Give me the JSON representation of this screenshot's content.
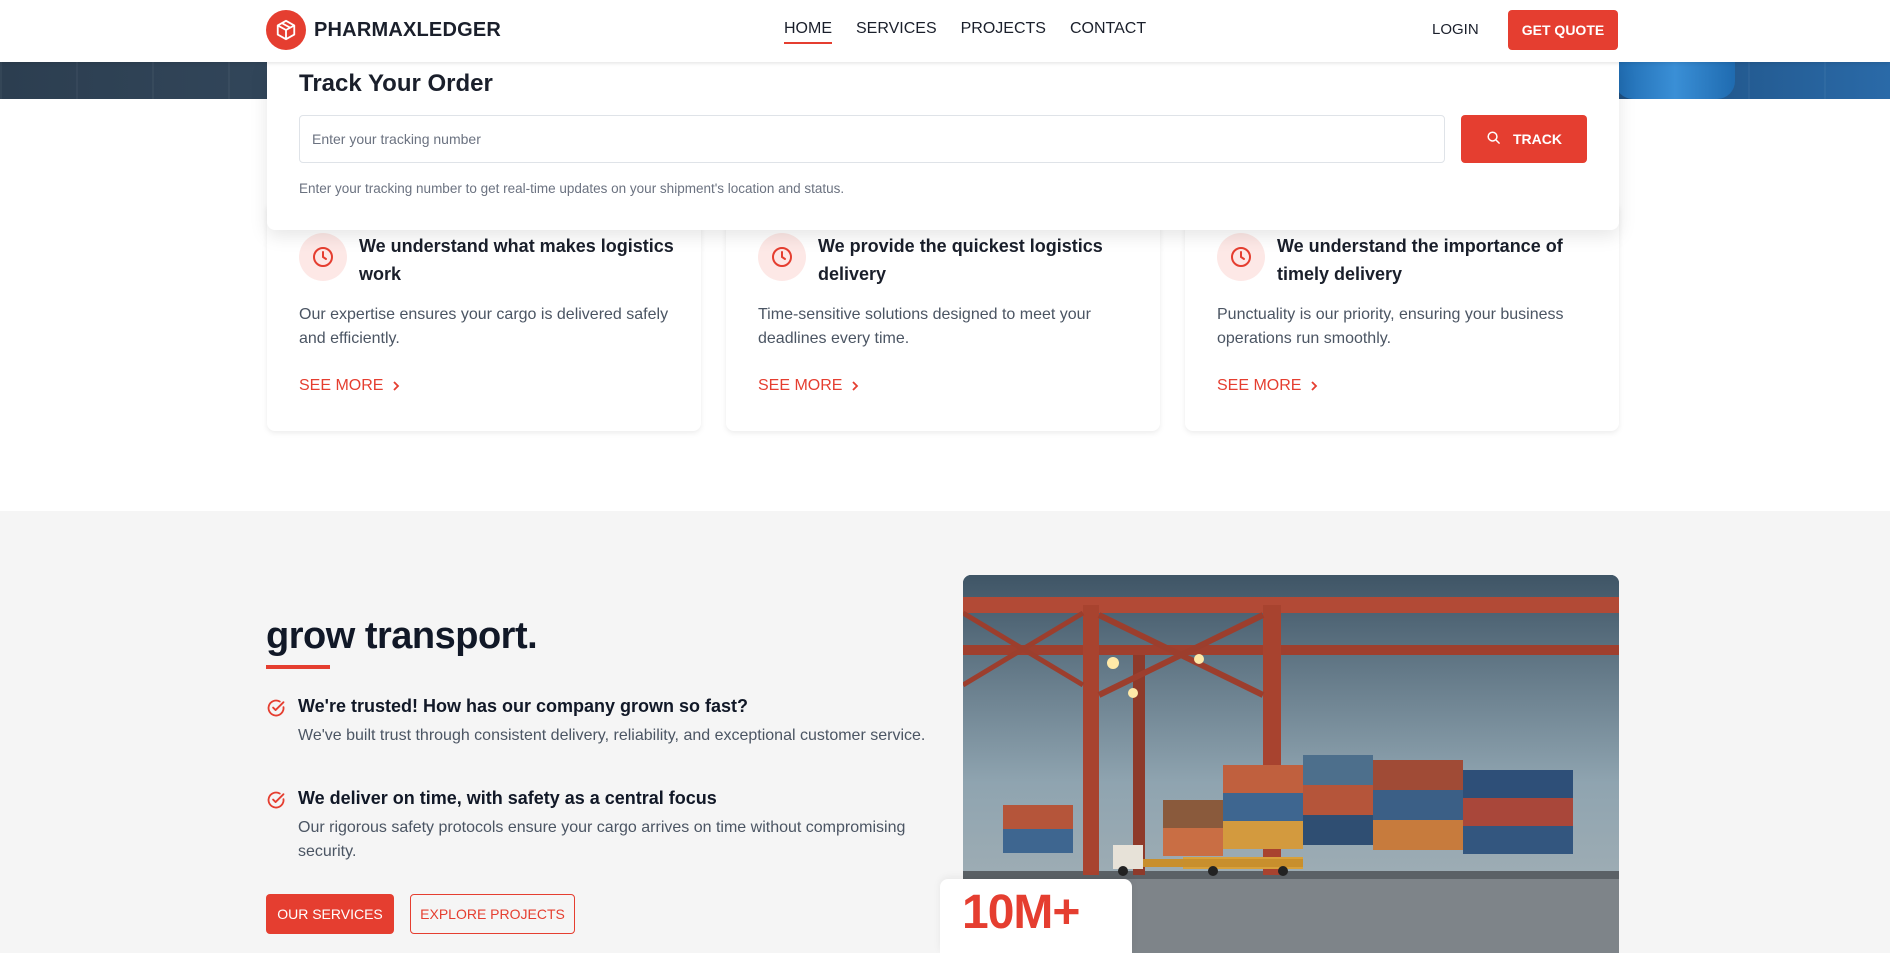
{
  "brand": {
    "name": "PHARMAXLEDGER",
    "accent_color": "#e53e30"
  },
  "nav": {
    "items": [
      {
        "label": "HOME",
        "active": true
      },
      {
        "label": "SERVICES",
        "active": false
      },
      {
        "label": "PROJECTS",
        "active": false
      },
      {
        "label": "CONTACT",
        "active": false
      }
    ],
    "login_label": "LOGIN",
    "quote_label": "GET QUOTE"
  },
  "tracking": {
    "title": "Track Your Order",
    "placeholder": "Enter your tracking number",
    "button_label": "TRACK",
    "button_icon": "search-icon",
    "help_text": "Enter your tracking number to get real-time updates on your shipment's location and status."
  },
  "features": [
    {
      "icon": "clock-icon",
      "title": "We understand what makes logistics work",
      "text": "Our expertise ensures your cargo is delivered safely and efficiently.",
      "link_label": "SEE MORE"
    },
    {
      "icon": "clock-icon",
      "title": "We provide the quickest logistics delivery",
      "text": "Time-sensitive solutions designed to meet your deadlines every time.",
      "link_label": "SEE MORE"
    },
    {
      "icon": "clock-icon",
      "title": "We understand the importance of timely delivery",
      "text": "Punctuality is our priority, ensuring your business operations run smoothly.",
      "link_label": "SEE MORE"
    }
  ],
  "about": {
    "title": "grow transport.",
    "points": [
      {
        "icon": "check-circle-icon",
        "title": "We're trusted! How has our company grown so fast?",
        "text": "We've built trust through consistent delivery, reliability, and exceptional customer service."
      },
      {
        "icon": "check-circle-icon",
        "title": "We deliver on time, with safety as a central focus",
        "text": "Our rigorous safety protocols ensure your cargo arrives on time without compromising security."
      }
    ],
    "primary_button": "OUR SERVICES",
    "secondary_button": "EXPLORE PROJECTS",
    "stat_value": "10M+",
    "image": "container-port-cranes-image"
  }
}
